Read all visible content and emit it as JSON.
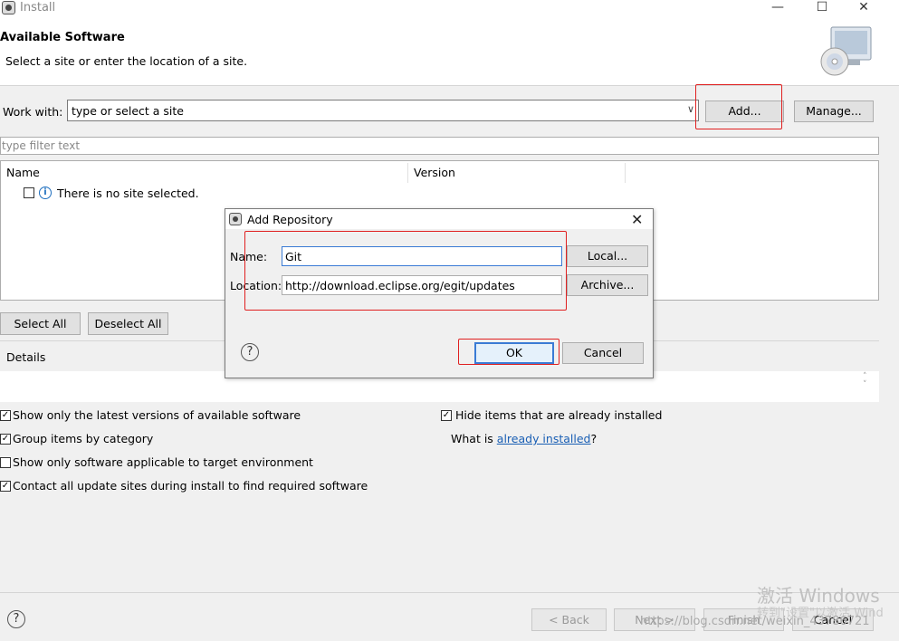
{
  "window": {
    "title": "Install",
    "minimize": "—",
    "maximize": "☐",
    "close": "✕"
  },
  "header": {
    "title": "Available Software",
    "subtitle": "Select a site or enter the location of a site."
  },
  "work_with": {
    "label": "Work with:",
    "value": "type or select a site",
    "add_label": "Add...",
    "manage_label": "Manage..."
  },
  "filter": {
    "placeholder": "type filter text"
  },
  "table": {
    "columns": [
      "Name",
      "Version"
    ],
    "empty_message": "There is no site selected."
  },
  "buttons": {
    "select_all": "Select All",
    "deselect_all": "Deselect All"
  },
  "details": {
    "label": "Details"
  },
  "options": {
    "latest_versions": {
      "label": "Show only the latest versions of available software",
      "checked": true
    },
    "group_by_category": {
      "label": "Group items by category",
      "checked": true
    },
    "target_env": {
      "label": "Show only software applicable to target environment",
      "checked": false
    },
    "contact_sites": {
      "label": "Contact all update sites during install to find required software",
      "checked": true
    },
    "hide_installed": {
      "label": "Hide items that are already installed",
      "checked": true
    },
    "what_is_prefix": "What is ",
    "what_is_link": "already installed",
    "what_is_suffix": "?"
  },
  "nav": {
    "back": "< Back",
    "next": "Next >",
    "finish": "Finish",
    "cancel": "Cancel"
  },
  "watermark": {
    "line1": "激活 Windows",
    "line2": "转到\"设置\"以激活 Wind",
    "csdn": "https://blog.csdn.net/weixin_43786721"
  },
  "dialog": {
    "title": "Add Repository",
    "name_label": "Name:",
    "name_value": "Git",
    "location_label": "Location:",
    "location_value": "http://download.eclipse.org/egit/updates",
    "local_label": "Local...",
    "archive_label": "Archive...",
    "ok_label": "OK",
    "cancel_label": "Cancel"
  },
  "colors": {
    "highlight": "#e02020",
    "link": "#1a5fb4",
    "focus": "#3a7bd5"
  },
  "icons": [
    "app-icon",
    "wizard-cd-icon",
    "info-icon",
    "help-icon",
    "close-icon",
    "dropdown-arrow-icon"
  ]
}
